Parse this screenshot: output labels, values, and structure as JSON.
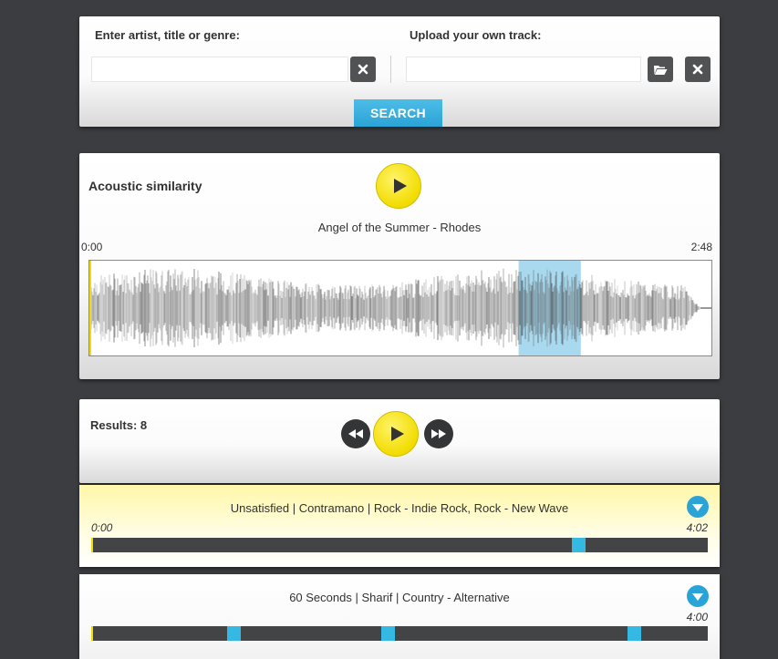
{
  "search": {
    "artist_label": "Enter artist, title or genre:",
    "artist_value": "",
    "upload_label": "Upload your own track:",
    "upload_value": "",
    "button_label": "SEARCH"
  },
  "acoustic": {
    "title": "Acoustic similarity",
    "track": "Angel of the Summer - Rhodes",
    "start_time": "0:00",
    "end_time": "2:48",
    "highlight_start": 0.69,
    "highlight_end": 0.79
  },
  "results": {
    "label": "Results: 8",
    "items": [
      {
        "title": "Unsatisfied | Contramano | Rock - Indie Rock, Rock - New Wave",
        "start_time": "0:00",
        "end_time": "4:02",
        "active": true,
        "markers": [
          0.78
        ]
      },
      {
        "title": "60 Seconds | Sharif | Country - Alternative",
        "start_time": "",
        "end_time": "4:00",
        "active": false,
        "markers": [
          0.22,
          0.47,
          0.87
        ]
      }
    ]
  },
  "colors": {
    "accent_blue": "#35b9e4",
    "play_yellow": "#f2dc00",
    "bar_dark": "#424446",
    "background": "#3b3d41"
  },
  "icons": {
    "clear": "close-icon",
    "folder": "folder-open-icon",
    "play": "play-icon",
    "prev": "rewind-icon",
    "next": "fast-forward-icon",
    "expand": "chevron-down-icon"
  }
}
